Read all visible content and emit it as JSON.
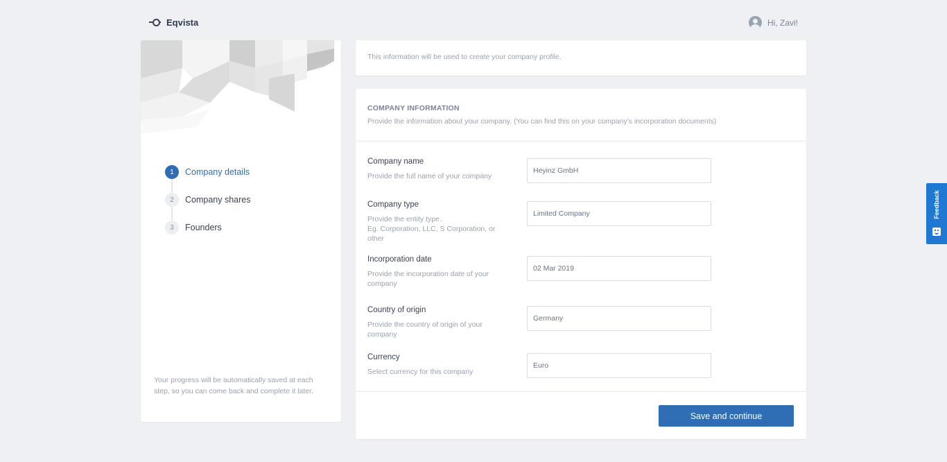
{
  "header": {
    "brand": "Eqvista",
    "greeting": "Hi, Zavi!"
  },
  "sidebar": {
    "steps": [
      {
        "number": "1",
        "label": "Company details",
        "active": true
      },
      {
        "number": "2",
        "label": "Company shares",
        "active": false
      },
      {
        "number": "3",
        "label": "Founders",
        "active": false
      }
    ],
    "autosave_note": "Your progress will be automatically saved at each step, so you can come back and complete it later."
  },
  "info_card": {
    "text": "This information will be used to create your company profile."
  },
  "form": {
    "section_title": "COMPANY INFORMATION",
    "section_description": "Provide the information about your company. (You can find this on your company's incorporation documents)",
    "fields": [
      {
        "label": "Company name",
        "help": "Provide the full name of your company",
        "value": "Heyinz GmbH"
      },
      {
        "label": "Company type",
        "help": "Provide the entity type.\nEg. Corporation, LLC, S Corporation, or other",
        "value": "Limited Company"
      },
      {
        "label": "Incorporation date",
        "help": "Provide the incorporation date of your company",
        "value": "02 Mar 2019"
      },
      {
        "label": "Country of origin",
        "help": "Provide the country of origin of your company",
        "value": "Germany"
      },
      {
        "label": "Currency",
        "help": "Select currency for this company",
        "value": "Euro"
      }
    ],
    "submit_label": "Save and continue"
  },
  "feedback": {
    "label": "Feedback"
  },
  "colors": {
    "accent": "#2f6db5",
    "feedback": "#1f78d1",
    "background": "#eef0f3"
  }
}
